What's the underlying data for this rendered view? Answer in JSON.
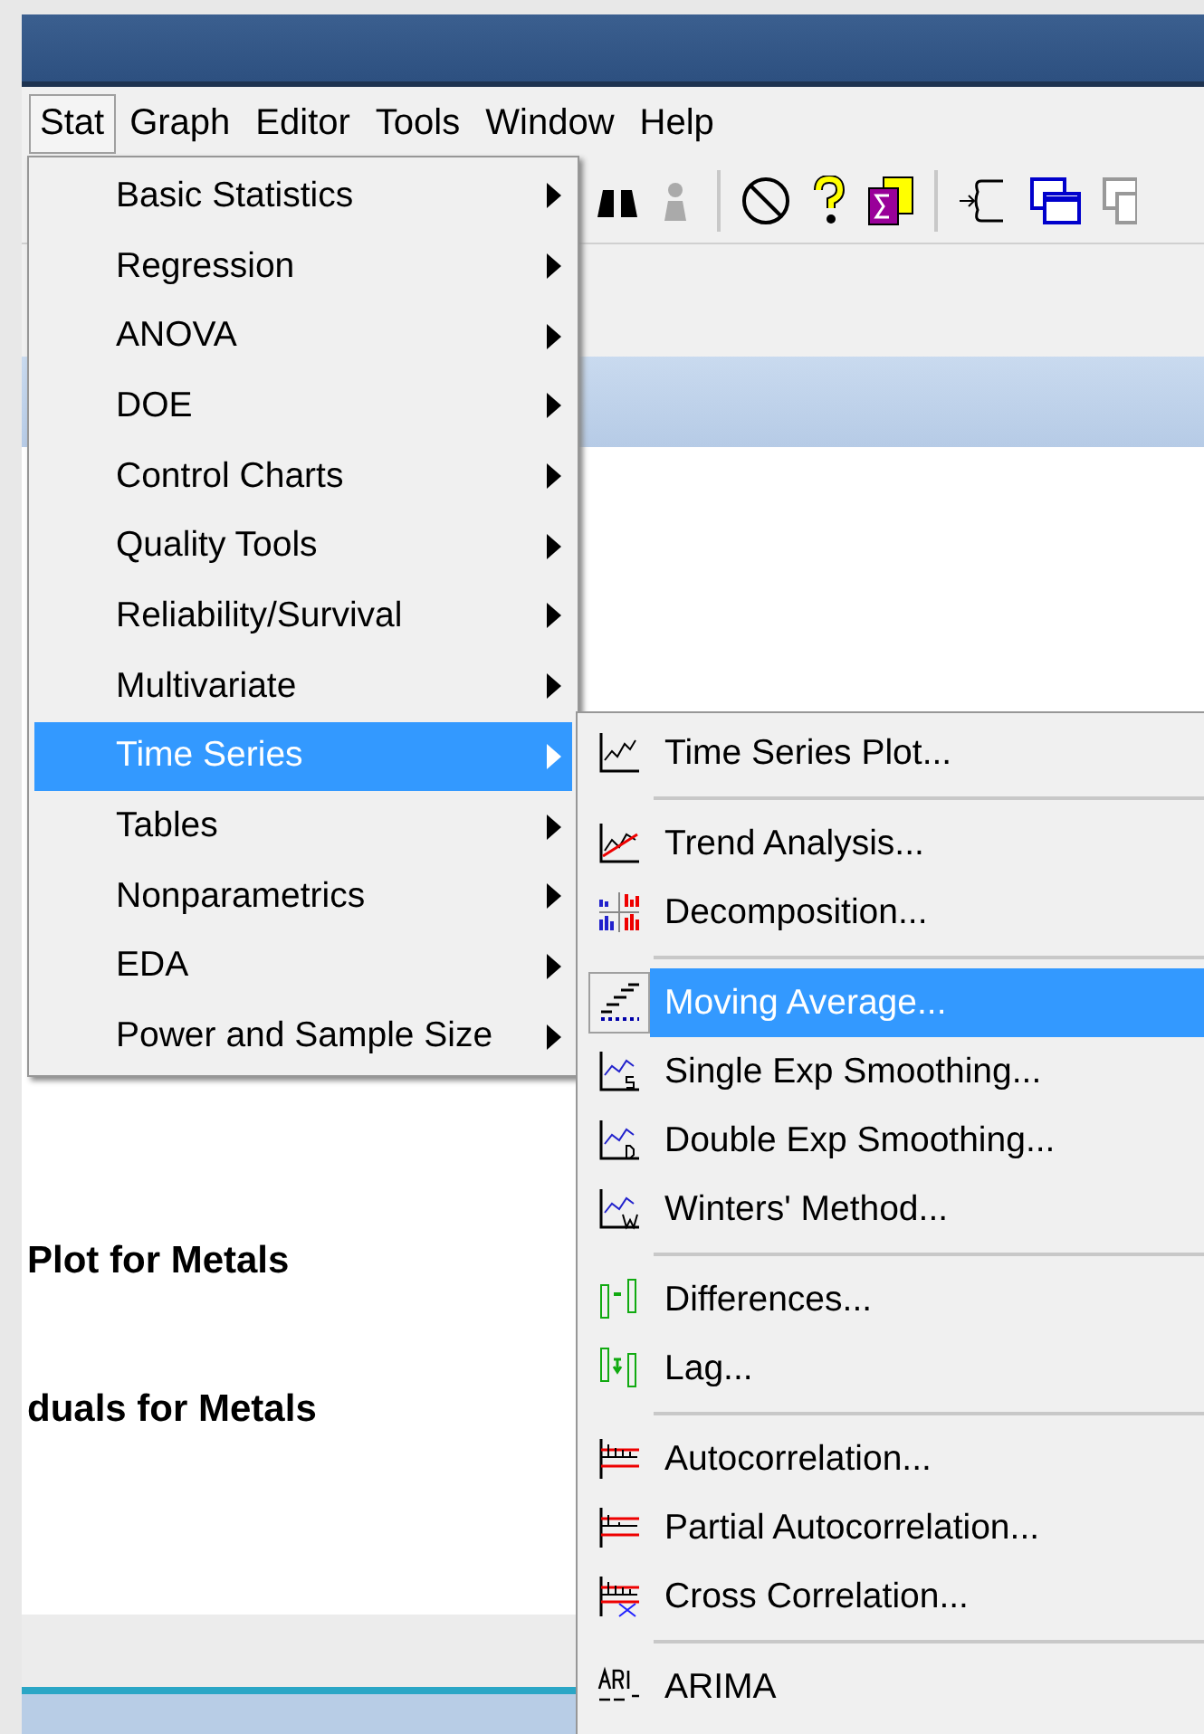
{
  "menu_bar": [
    {
      "label": "Stat",
      "selected": true
    },
    {
      "label": "Graph",
      "selected": false
    },
    {
      "label": "Editor",
      "selected": false
    },
    {
      "label": "Tools",
      "selected": false
    },
    {
      "label": "Window",
      "selected": false
    },
    {
      "label": "Help",
      "selected": false
    }
  ],
  "session": {
    "headings": [
      "Plot for Metals",
      "duals for Metals"
    ]
  },
  "stat_menu": [
    {
      "label": "Basic Statistics",
      "selected": false
    },
    {
      "label": "Regression",
      "selected": false
    },
    {
      "label": "ANOVA",
      "selected": false
    },
    {
      "label": "DOE",
      "selected": false
    },
    {
      "label": "Control Charts",
      "selected": false
    },
    {
      "label": "Quality Tools",
      "selected": false
    },
    {
      "label": "Reliability/Survival",
      "selected": false
    },
    {
      "label": "Multivariate",
      "selected": false
    },
    {
      "label": "Time Series",
      "selected": true
    },
    {
      "label": "Tables",
      "selected": false
    },
    {
      "label": "Nonparametrics",
      "selected": false
    },
    {
      "label": "EDA",
      "selected": false
    },
    {
      "label": "Power and Sample Size",
      "selected": false
    }
  ],
  "time_series_menu": [
    {
      "kind": "item",
      "label": "Time Series Plot...",
      "selected": false
    },
    {
      "kind": "separator"
    },
    {
      "kind": "item",
      "label": "Trend Analysis...",
      "selected": false
    },
    {
      "kind": "item",
      "label": "Decomposition...",
      "selected": false
    },
    {
      "kind": "separator"
    },
    {
      "kind": "item",
      "label": "Moving Average...",
      "selected": true
    },
    {
      "kind": "item",
      "label": "Single Exp Smoothing...",
      "selected": false
    },
    {
      "kind": "item",
      "label": "Double Exp Smoothing...",
      "selected": false
    },
    {
      "kind": "item",
      "label": "Winters' Method...",
      "selected": false
    },
    {
      "kind": "separator"
    },
    {
      "kind": "item",
      "label": "Differences...",
      "selected": false
    },
    {
      "kind": "item",
      "label": "Lag...",
      "selected": false
    },
    {
      "kind": "separator"
    },
    {
      "kind": "item",
      "label": "Autocorrelation...",
      "selected": false
    },
    {
      "kind": "item",
      "label": "Partial Autocorrelation...",
      "selected": false
    },
    {
      "kind": "item",
      "label": "Cross Correlation...",
      "selected": false
    },
    {
      "kind": "separator"
    },
    {
      "kind": "item",
      "label": "ARIMA",
      "selected": false
    }
  ]
}
